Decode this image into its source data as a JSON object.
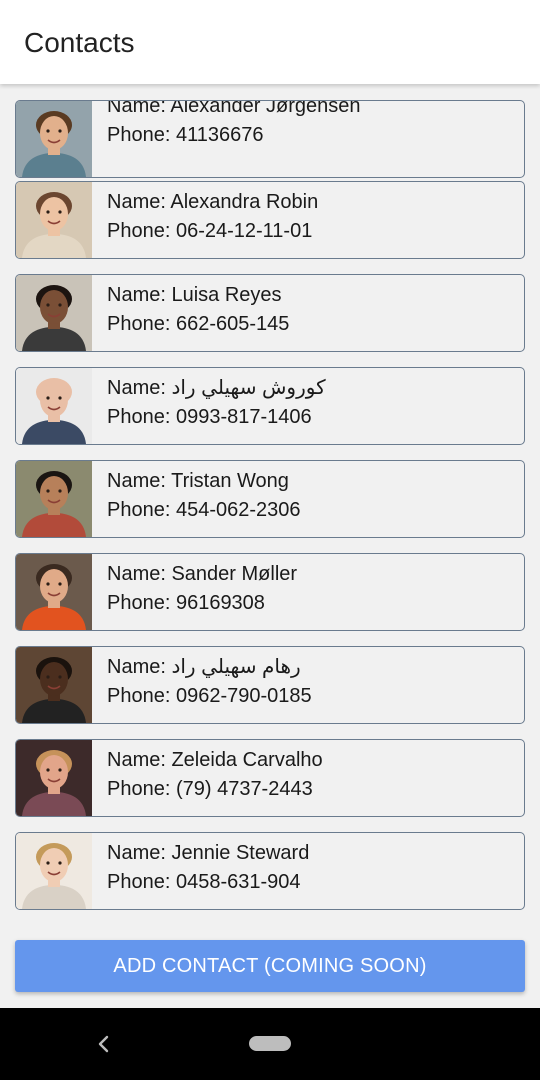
{
  "app_bar": {
    "title": "Contacts"
  },
  "contacts": [
    {
      "name_label": "Name: Alexander Jørgensen",
      "phone_label": "Phone: 41136676",
      "avatar_icon": "person-photo-icon",
      "skin": "#e2b08c",
      "hair": "#5a3b22",
      "shirt": "#5b7f8f",
      "bg": "#93a3ab"
    },
    {
      "name_label": "Name: Alexandra Robin",
      "phone_label": "Phone: 06-24-12-11-01",
      "avatar_icon": "person-photo-icon",
      "skin": "#edc3a3",
      "hair": "#6b4630",
      "shirt": "#e3d7c4",
      "bg": "#d6c8b3"
    },
    {
      "name_label": "Name: Luisa Reyes",
      "phone_label": "Phone: 662-605-145",
      "avatar_icon": "person-photo-icon",
      "skin": "#7a4f36",
      "hair": "#1c1410",
      "shirt": "#3a3a3a",
      "bg": "#c9c3b8"
    },
    {
      "name_label": "Name: كوروش سهيلي راد",
      "phone_label": "Phone: 0993-817-1406",
      "avatar_icon": "person-photo-icon",
      "skin": "#e9bfa6",
      "hair": "#e9bfa6",
      "shirt": "#3b4a64",
      "bg": "#eaeaea"
    },
    {
      "name_label": "Name: Tristan Wong",
      "phone_label": "Phone: 454-062-2306",
      "avatar_icon": "person-photo-icon",
      "skin": "#b7805a",
      "hair": "#1a1512",
      "shirt": "#b24b3a",
      "bg": "#8b8a6f"
    },
    {
      "name_label": "Name: Sander Møller",
      "phone_label": "Phone: 96169308",
      "avatar_icon": "person-photo-icon",
      "skin": "#e0aa88",
      "hair": "#3a2a20",
      "shirt": "#e2531f",
      "bg": "#6b5a4c"
    },
    {
      "name_label": "Name: رهام سهيلي راد",
      "phone_label": "Phone: 0962-790-0185",
      "avatar_icon": "person-photo-icon",
      "skin": "#4b2e1e",
      "hair": "#1a120d",
      "shirt": "#222222",
      "bg": "#5e4634"
    },
    {
      "name_label": "Name: Zeleida Carvalho",
      "phone_label": "Phone: (79) 4737-2443",
      "avatar_icon": "person-photo-icon",
      "skin": "#e2a58a",
      "hair": "#c6925a",
      "shirt": "#7a4a55",
      "bg": "#3d2a2a"
    },
    {
      "name_label": "Name: Jennie Steward",
      "phone_label": "Phone: 0458-631-904",
      "avatar_icon": "person-photo-icon",
      "skin": "#f0cdb4",
      "hair": "#c49a5a",
      "shirt": "#d9d1c6",
      "bg": "#efe9e1"
    }
  ],
  "add_button": {
    "label": "ADD CONTACT (COMING SOON)",
    "color": "#6496ed"
  },
  "nav": {
    "back_icon": "chevron-left-icon",
    "home_icon": "home-pill-icon"
  }
}
